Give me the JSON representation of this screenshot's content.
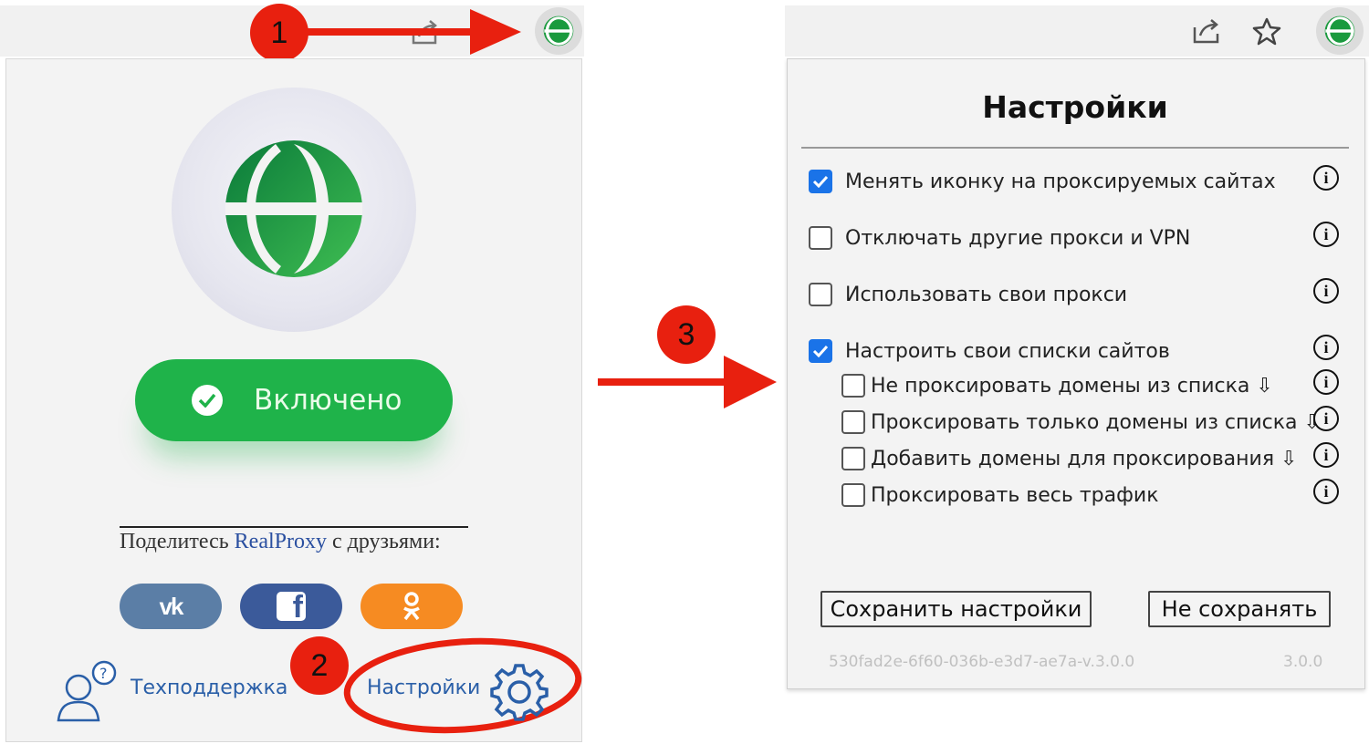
{
  "colors": {
    "accent_red": "#e8200f",
    "toggle_green": "#1fb34a",
    "link_blue": "#2a5fa8",
    "checkbox_blue": "#1a73e8"
  },
  "steps": [
    "1",
    "2",
    "3"
  ],
  "left_popup": {
    "toggle_label": "Включено",
    "share_prefix": "Поделитесь",
    "share_brand": "RealProxy",
    "share_suffix": "с друзьями:",
    "social": [
      {
        "name": "vk",
        "icon": "vk-icon",
        "color": "#5b7ea6"
      },
      {
        "name": "facebook",
        "icon": "facebook-icon",
        "color": "#3b5a9a"
      },
      {
        "name": "odnoklassniki",
        "icon": "ok-icon",
        "color": "#f68b22"
      }
    ],
    "support_label": "Техподдержка",
    "settings_label": "Настройки"
  },
  "settings": {
    "title": "Настройки",
    "options": [
      {
        "label": "Менять иконку на проксируемых сайтах",
        "checked": true
      },
      {
        "label": "Отключать другие прокси и VPN",
        "checked": false
      },
      {
        "label": "Использовать свои прокси",
        "checked": false
      },
      {
        "label": "Настроить свои списки сайтов",
        "checked": true
      }
    ],
    "sub_options": [
      {
        "label": "Не проксировать домены из списка ⇩",
        "checked": false
      },
      {
        "label": "Проксировать только домены из списка ⇩",
        "checked": false
      },
      {
        "label": "Добавить домены для проксирования ⇩",
        "checked": false
      },
      {
        "label": "Проксировать весь трафик",
        "checked": false
      }
    ],
    "info_glyph": "i",
    "save_label": "Сохранить настройки",
    "cancel_label": "Не сохранять",
    "extension_id": "530fad2e-6f60-036b-e3d7-ae7a-v.3.0.0",
    "version": "3.0.0"
  }
}
